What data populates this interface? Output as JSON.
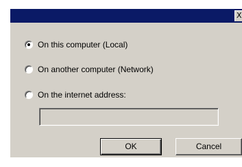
{
  "window": {
    "title": "",
    "close_label": "X"
  },
  "options": [
    {
      "label": "On this computer (Local)",
      "selected": true
    },
    {
      "label": "On another computer (Network)",
      "selected": false
    },
    {
      "label": "On the internet address:",
      "selected": false
    }
  ],
  "address_field": {
    "value": "",
    "placeholder": ""
  },
  "buttons": {
    "ok_label": "OK",
    "cancel_label": "Cancel"
  },
  "colors": {
    "titlebar": "#0a1a66",
    "panel": "#d4d0c8"
  }
}
